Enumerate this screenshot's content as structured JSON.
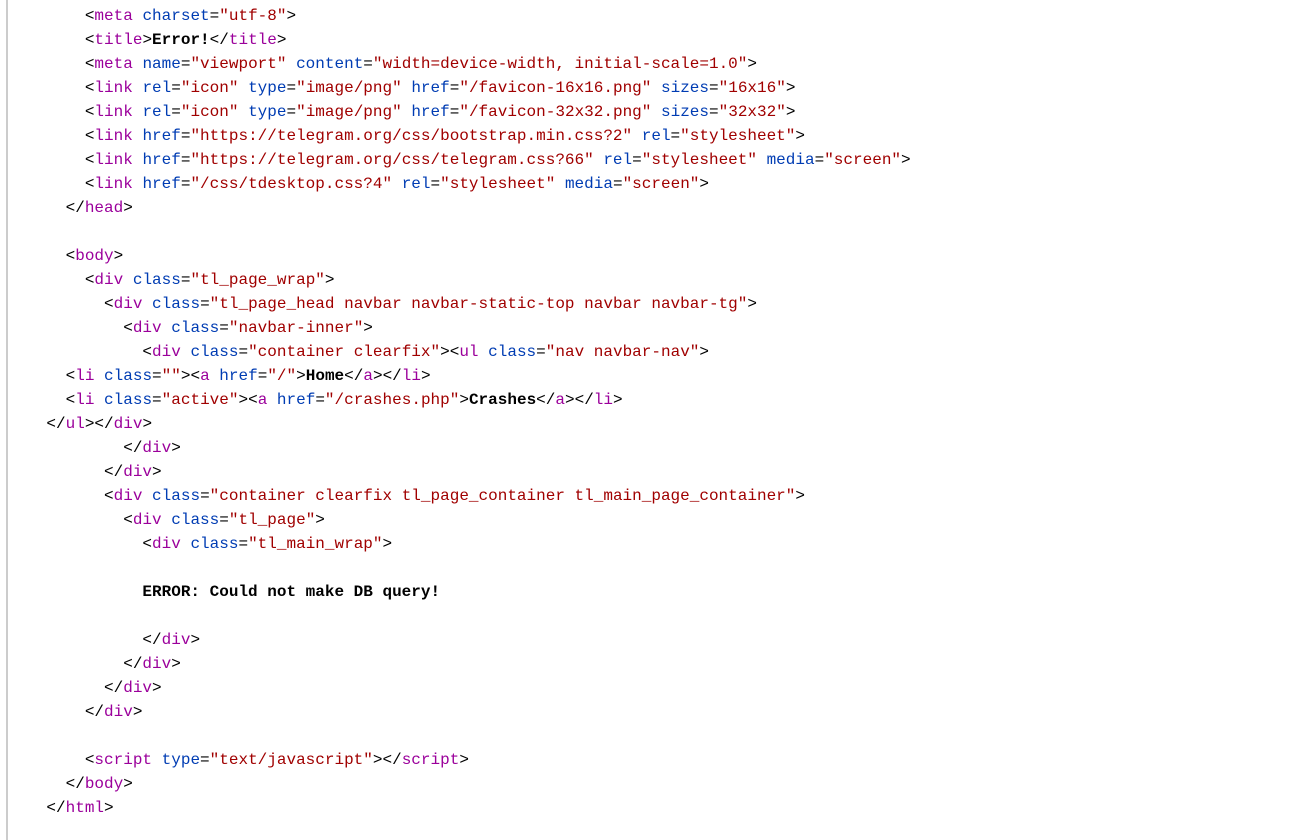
{
  "lines": {
    "l1": {
      "indent": "        ",
      "tokens": [
        [
          "br",
          "<"
        ],
        [
          "tag",
          "meta"
        ],
        [
          "br",
          " "
        ],
        [
          "attrk",
          "charset"
        ],
        [
          "br",
          "="
        ],
        [
          "attrv",
          "\"utf-8\""
        ],
        [
          "br",
          ">"
        ]
      ]
    },
    "l2": {
      "indent": "        ",
      "tokens": [
        [
          "br",
          "<"
        ],
        [
          "tag",
          "title"
        ],
        [
          "br",
          ">"
        ],
        [
          "txt",
          "Error!"
        ],
        [
          "br",
          "</"
        ],
        [
          "tag",
          "title"
        ],
        [
          "br",
          ">"
        ]
      ]
    },
    "l3": {
      "indent": "        ",
      "tokens": [
        [
          "br",
          "<"
        ],
        [
          "tag",
          "meta"
        ],
        [
          "br",
          " "
        ],
        [
          "attrk",
          "name"
        ],
        [
          "br",
          "="
        ],
        [
          "attrv",
          "\"viewport\""
        ],
        [
          "br",
          " "
        ],
        [
          "attrk",
          "content"
        ],
        [
          "br",
          "="
        ],
        [
          "attrv",
          "\"width=device-width, initial-scale=1.0\""
        ],
        [
          "br",
          ">"
        ]
      ]
    },
    "l4": {
      "indent": "        ",
      "tokens": [
        [
          "br",
          "<"
        ],
        [
          "tag",
          "link"
        ],
        [
          "br",
          " "
        ],
        [
          "attrk",
          "rel"
        ],
        [
          "br",
          "="
        ],
        [
          "attrv",
          "\"icon\""
        ],
        [
          "br",
          " "
        ],
        [
          "attrk",
          "type"
        ],
        [
          "br",
          "="
        ],
        [
          "attrv",
          "\"image/png\""
        ],
        [
          "br",
          " "
        ],
        [
          "attrk",
          "href"
        ],
        [
          "br",
          "="
        ],
        [
          "attrv",
          "\"/favicon-16x16.png\""
        ],
        [
          "br",
          " "
        ],
        [
          "attrk",
          "sizes"
        ],
        [
          "br",
          "="
        ],
        [
          "attrv",
          "\"16x16\""
        ],
        [
          "br",
          ">"
        ]
      ]
    },
    "l5": {
      "indent": "        ",
      "tokens": [
        [
          "br",
          "<"
        ],
        [
          "tag",
          "link"
        ],
        [
          "br",
          " "
        ],
        [
          "attrk",
          "rel"
        ],
        [
          "br",
          "="
        ],
        [
          "attrv",
          "\"icon\""
        ],
        [
          "br",
          " "
        ],
        [
          "attrk",
          "type"
        ],
        [
          "br",
          "="
        ],
        [
          "attrv",
          "\"image/png\""
        ],
        [
          "br",
          " "
        ],
        [
          "attrk",
          "href"
        ],
        [
          "br",
          "="
        ],
        [
          "attrv",
          "\"/favicon-32x32.png\""
        ],
        [
          "br",
          " "
        ],
        [
          "attrk",
          "sizes"
        ],
        [
          "br",
          "="
        ],
        [
          "attrv",
          "\"32x32\""
        ],
        [
          "br",
          ">"
        ]
      ]
    },
    "l6": {
      "indent": "        ",
      "tokens": [
        [
          "br",
          "<"
        ],
        [
          "tag",
          "link"
        ],
        [
          "br",
          " "
        ],
        [
          "attrk",
          "href"
        ],
        [
          "br",
          "="
        ],
        [
          "attrv",
          "\"https://telegram.org/css/bootstrap.min.css?2\""
        ],
        [
          "br",
          " "
        ],
        [
          "attrk",
          "rel"
        ],
        [
          "br",
          "="
        ],
        [
          "attrv",
          "\"stylesheet\""
        ],
        [
          "br",
          ">"
        ]
      ]
    },
    "l7": {
      "indent": "        ",
      "tokens": [
        [
          "br",
          "<"
        ],
        [
          "tag",
          "link"
        ],
        [
          "br",
          " "
        ],
        [
          "attrk",
          "href"
        ],
        [
          "br",
          "="
        ],
        [
          "attrv",
          "\"https://telegram.org/css/telegram.css?66\""
        ],
        [
          "br",
          " "
        ],
        [
          "attrk",
          "rel"
        ],
        [
          "br",
          "="
        ],
        [
          "attrv",
          "\"stylesheet\""
        ],
        [
          "br",
          " "
        ],
        [
          "attrk",
          "media"
        ],
        [
          "br",
          "="
        ],
        [
          "attrv",
          "\"screen\""
        ],
        [
          "br",
          ">"
        ]
      ]
    },
    "l8": {
      "indent": "        ",
      "tokens": [
        [
          "br",
          "<"
        ],
        [
          "tag",
          "link"
        ],
        [
          "br",
          " "
        ],
        [
          "attrk",
          "href"
        ],
        [
          "br",
          "="
        ],
        [
          "attrv",
          "\"/css/tdesktop.css?4\""
        ],
        [
          "br",
          " "
        ],
        [
          "attrk",
          "rel"
        ],
        [
          "br",
          "="
        ],
        [
          "attrv",
          "\"stylesheet\""
        ],
        [
          "br",
          " "
        ],
        [
          "attrk",
          "media"
        ],
        [
          "br",
          "="
        ],
        [
          "attrv",
          "\"screen\""
        ],
        [
          "br",
          ">"
        ]
      ]
    },
    "l9": {
      "indent": "      ",
      "tokens": [
        [
          "br",
          "</"
        ],
        [
          "tag",
          "head"
        ],
        [
          "br",
          ">"
        ]
      ]
    },
    "l10": {
      "indent": "",
      "tokens": []
    },
    "l11": {
      "indent": "      ",
      "tokens": [
        [
          "br",
          "<"
        ],
        [
          "tag",
          "body"
        ],
        [
          "br",
          ">"
        ]
      ]
    },
    "l12": {
      "indent": "        ",
      "tokens": [
        [
          "br",
          "<"
        ],
        [
          "tag",
          "div"
        ],
        [
          "br",
          " "
        ],
        [
          "attrk",
          "class"
        ],
        [
          "br",
          "="
        ],
        [
          "attrv",
          "\"tl_page_wrap\""
        ],
        [
          "br",
          ">"
        ]
      ]
    },
    "l13": {
      "indent": "          ",
      "tokens": [
        [
          "br",
          "<"
        ],
        [
          "tag",
          "div"
        ],
        [
          "br",
          " "
        ],
        [
          "attrk",
          "class"
        ],
        [
          "br",
          "="
        ],
        [
          "attrv",
          "\"tl_page_head navbar navbar-static-top navbar navbar-tg\""
        ],
        [
          "br",
          ">"
        ]
      ]
    },
    "l14": {
      "indent": "            ",
      "tokens": [
        [
          "br",
          "<"
        ],
        [
          "tag",
          "div"
        ],
        [
          "br",
          " "
        ],
        [
          "attrk",
          "class"
        ],
        [
          "br",
          "="
        ],
        [
          "attrv",
          "\"navbar-inner\""
        ],
        [
          "br",
          ">"
        ]
      ]
    },
    "l15": {
      "indent": "              ",
      "tokens": [
        [
          "br",
          "<"
        ],
        [
          "tag",
          "div"
        ],
        [
          "br",
          " "
        ],
        [
          "attrk",
          "class"
        ],
        [
          "br",
          "="
        ],
        [
          "attrv",
          "\"container clearfix\""
        ],
        [
          "br",
          ">"
        ],
        [
          "br",
          "<"
        ],
        [
          "tag",
          "ul"
        ],
        [
          "br",
          " "
        ],
        [
          "attrk",
          "class"
        ],
        [
          "br",
          "="
        ],
        [
          "attrv",
          "\"nav navbar-nav\""
        ],
        [
          "br",
          ">"
        ]
      ]
    },
    "l16": {
      "indent": "      ",
      "tokens": [
        [
          "br",
          "<"
        ],
        [
          "tag",
          "li"
        ],
        [
          "br",
          " "
        ],
        [
          "attrk",
          "class"
        ],
        [
          "br",
          "="
        ],
        [
          "attrv",
          "\"\""
        ],
        [
          "br",
          ">"
        ],
        [
          "br",
          "<"
        ],
        [
          "tag",
          "a"
        ],
        [
          "br",
          " "
        ],
        [
          "attrk",
          "href"
        ],
        [
          "br",
          "="
        ],
        [
          "attrv",
          "\"/\""
        ],
        [
          "br",
          ">"
        ],
        [
          "txt",
          "Home"
        ],
        [
          "br",
          "</"
        ],
        [
          "tag",
          "a"
        ],
        [
          "br",
          ">"
        ],
        [
          "br",
          "</"
        ],
        [
          "tag",
          "li"
        ],
        [
          "br",
          ">"
        ]
      ]
    },
    "l17": {
      "indent": "      ",
      "tokens": [
        [
          "br",
          "<"
        ],
        [
          "tag",
          "li"
        ],
        [
          "br",
          " "
        ],
        [
          "attrk",
          "class"
        ],
        [
          "br",
          "="
        ],
        [
          "attrv",
          "\"active\""
        ],
        [
          "br",
          ">"
        ],
        [
          "br",
          "<"
        ],
        [
          "tag",
          "a"
        ],
        [
          "br",
          " "
        ],
        [
          "attrk",
          "href"
        ],
        [
          "br",
          "="
        ],
        [
          "attrv",
          "\"/crashes.php\""
        ],
        [
          "br",
          ">"
        ],
        [
          "txt",
          "Crashes"
        ],
        [
          "br",
          "</"
        ],
        [
          "tag",
          "a"
        ],
        [
          "br",
          ">"
        ],
        [
          "br",
          "</"
        ],
        [
          "tag",
          "li"
        ],
        [
          "br",
          ">"
        ]
      ]
    },
    "l18": {
      "indent": "    ",
      "tokens": [
        [
          "br",
          "</"
        ],
        [
          "tag",
          "ul"
        ],
        [
          "br",
          ">"
        ],
        [
          "br",
          "</"
        ],
        [
          "tag",
          "div"
        ],
        [
          "br",
          ">"
        ]
      ]
    },
    "l19": {
      "indent": "            ",
      "tokens": [
        [
          "br",
          "</"
        ],
        [
          "tag",
          "div"
        ],
        [
          "br",
          ">"
        ]
      ]
    },
    "l20": {
      "indent": "          ",
      "tokens": [
        [
          "br",
          "</"
        ],
        [
          "tag",
          "div"
        ],
        [
          "br",
          ">"
        ]
      ]
    },
    "l21": {
      "indent": "          ",
      "tokens": [
        [
          "br",
          "<"
        ],
        [
          "tag",
          "div"
        ],
        [
          "br",
          " "
        ],
        [
          "attrk",
          "class"
        ],
        [
          "br",
          "="
        ],
        [
          "attrv",
          "\"container clearfix tl_page_container tl_main_page_container\""
        ],
        [
          "br",
          ">"
        ]
      ]
    },
    "l22": {
      "indent": "            ",
      "tokens": [
        [
          "br",
          "<"
        ],
        [
          "tag",
          "div"
        ],
        [
          "br",
          " "
        ],
        [
          "attrk",
          "class"
        ],
        [
          "br",
          "="
        ],
        [
          "attrv",
          "\"tl_page\""
        ],
        [
          "br",
          ">"
        ]
      ]
    },
    "l23": {
      "indent": "              ",
      "tokens": [
        [
          "br",
          "<"
        ],
        [
          "tag",
          "div"
        ],
        [
          "br",
          " "
        ],
        [
          "attrk",
          "class"
        ],
        [
          "br",
          "="
        ],
        [
          "attrv",
          "\"tl_main_wrap\""
        ],
        [
          "br",
          ">"
        ]
      ]
    },
    "l24": {
      "indent": "",
      "tokens": []
    },
    "l25": {
      "indent": "              ",
      "tokens": [
        [
          "txt",
          "ERROR: Could not make DB query!"
        ]
      ]
    },
    "l26": {
      "indent": "",
      "tokens": []
    },
    "l27": {
      "indent": "              ",
      "tokens": [
        [
          "br",
          "</"
        ],
        [
          "tag",
          "div"
        ],
        [
          "br",
          ">"
        ]
      ]
    },
    "l28": {
      "indent": "            ",
      "tokens": [
        [
          "br",
          "</"
        ],
        [
          "tag",
          "div"
        ],
        [
          "br",
          ">"
        ]
      ]
    },
    "l29": {
      "indent": "          ",
      "tokens": [
        [
          "br",
          "</"
        ],
        [
          "tag",
          "div"
        ],
        [
          "br",
          ">"
        ]
      ]
    },
    "l30": {
      "indent": "        ",
      "tokens": [
        [
          "br",
          "</"
        ],
        [
          "tag",
          "div"
        ],
        [
          "br",
          ">"
        ]
      ]
    },
    "l31": {
      "indent": "",
      "tokens": []
    },
    "l32": {
      "indent": "        ",
      "tokens": [
        [
          "br",
          "<"
        ],
        [
          "tag",
          "script"
        ],
        [
          "br",
          " "
        ],
        [
          "attrk",
          "type"
        ],
        [
          "br",
          "="
        ],
        [
          "attrv",
          "\"text/javascript\""
        ],
        [
          "br",
          ">"
        ],
        [
          "br",
          "</"
        ],
        [
          "tag",
          "script"
        ],
        [
          "br",
          ">"
        ]
      ]
    },
    "l33": {
      "indent": "      ",
      "tokens": [
        [
          "br",
          "</"
        ],
        [
          "tag",
          "body"
        ],
        [
          "br",
          ">"
        ]
      ]
    },
    "l34": {
      "indent": "    ",
      "tokens": [
        [
          "br",
          "</"
        ],
        [
          "tag",
          "html"
        ],
        [
          "br",
          ">"
        ]
      ]
    }
  },
  "order": [
    "l1",
    "l2",
    "l3",
    "l4",
    "l5",
    "l6",
    "l7",
    "l8",
    "l9",
    "l10",
    "l11",
    "l12",
    "l13",
    "l14",
    "l15",
    "l16",
    "l17",
    "l18",
    "l19",
    "l20",
    "l21",
    "l22",
    "l23",
    "l24",
    "l25",
    "l26",
    "l27",
    "l28",
    "l29",
    "l30",
    "l31",
    "l32",
    "l33",
    "l34"
  ]
}
